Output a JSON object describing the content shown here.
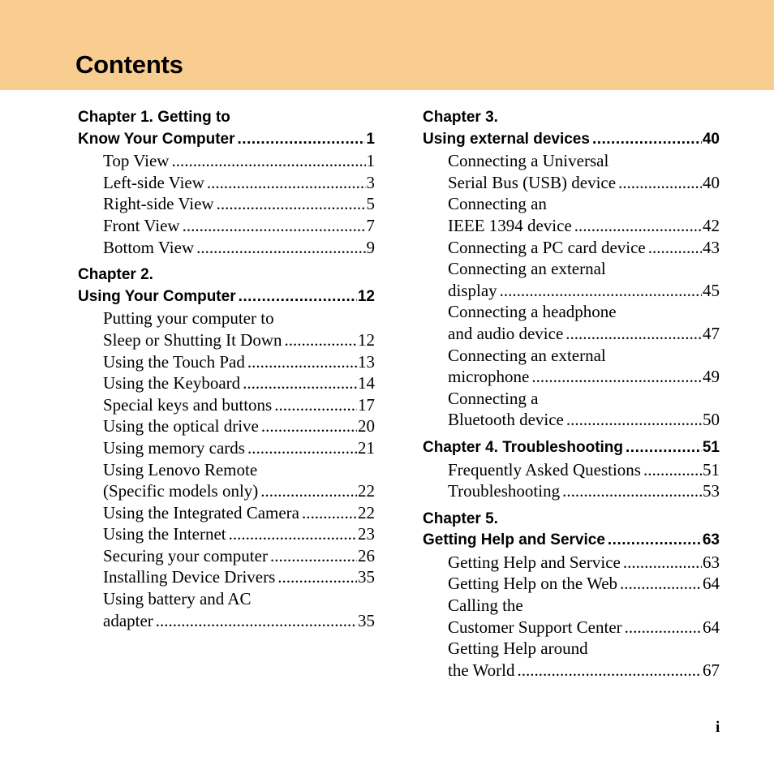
{
  "header": {
    "title": "Contents",
    "band_color": "#F9CC90"
  },
  "columns": [
    {
      "chapters": [
        {
          "title_lines": [
            "Chapter 1. Getting to",
            "Know Your Computer"
          ],
          "page": "1",
          "entries": [
            {
              "lines": [
                "Top View"
              ],
              "page": "1"
            },
            {
              "lines": [
                "Left-side View"
              ],
              "page": "3"
            },
            {
              "lines": [
                "Right-side View"
              ],
              "page": "5"
            },
            {
              "lines": [
                "Front View"
              ],
              "page": "7"
            },
            {
              "lines": [
                "Bottom View"
              ],
              "page": "9"
            }
          ]
        },
        {
          "title_lines": [
            "Chapter 2.",
            "Using Your Computer"
          ],
          "page": "12",
          "entries": [
            {
              "lines": [
                "Putting your computer to",
                "Sleep or Shutting It Down"
              ],
              "page": "12"
            },
            {
              "lines": [
                "Using the Touch Pad"
              ],
              "page": "13"
            },
            {
              "lines": [
                "Using the Keyboard"
              ],
              "page": "14"
            },
            {
              "lines": [
                "Special keys and buttons"
              ],
              "page": "17"
            },
            {
              "lines": [
                "Using the optical drive"
              ],
              "page": "20"
            },
            {
              "lines": [
                "Using memory cards"
              ],
              "page": "21"
            },
            {
              "lines": [
                "Using Lenovo Remote",
                "(Specific models only)"
              ],
              "page": "22"
            },
            {
              "lines": [
                "Using the Integrated Camera"
              ],
              "page": "22"
            },
            {
              "lines": [
                "Using the Internet"
              ],
              "page": "23"
            },
            {
              "lines": [
                "Securing your computer"
              ],
              "page": "26"
            },
            {
              "lines": [
                "Installing Device Drivers"
              ],
              "page": "35"
            },
            {
              "lines": [
                "Using battery and AC",
                "adapter"
              ],
              "page": "35"
            }
          ]
        }
      ]
    },
    {
      "chapters": [
        {
          "title_lines": [
            "Chapter 3.",
            "Using external devices"
          ],
          "page": "40",
          "entries": [
            {
              "lines": [
                "Connecting a Universal",
                "Serial Bus (USB) device"
              ],
              "page": "40"
            },
            {
              "lines": [
                "Connecting an",
                "IEEE 1394 device"
              ],
              "page": "42"
            },
            {
              "lines": [
                "Connecting a PC card device"
              ],
              "page": "43"
            },
            {
              "lines": [
                "Connecting an external",
                "display"
              ],
              "page": "45"
            },
            {
              "lines": [
                "Connecting a headphone",
                "and audio device"
              ],
              "page": "47"
            },
            {
              "lines": [
                "Connecting an external",
                "microphone"
              ],
              "page": "49"
            },
            {
              "lines": [
                "Connecting a",
                "Bluetooth device"
              ],
              "page": "50"
            }
          ]
        },
        {
          "title_lines": [
            "Chapter 4. Troubleshooting"
          ],
          "page": "51",
          "entries": [
            {
              "lines": [
                "Frequently Asked Questions"
              ],
              "page": "51"
            },
            {
              "lines": [
                "Troubleshooting"
              ],
              "page": "53"
            }
          ]
        },
        {
          "title_lines": [
            "Chapter 5.",
            "Getting Help and Service"
          ],
          "page": "63",
          "entries": [
            {
              "lines": [
                "Getting Help and Service"
              ],
              "page": "63"
            },
            {
              "lines": [
                "Getting Help on the Web"
              ],
              "page": "64"
            },
            {
              "lines": [
                "Calling the",
                "Customer Support Center"
              ],
              "page": "64"
            },
            {
              "lines": [
                "Getting Help around",
                "the World"
              ],
              "page": "67"
            }
          ]
        }
      ]
    }
  ],
  "footer": {
    "page_number": "i"
  }
}
